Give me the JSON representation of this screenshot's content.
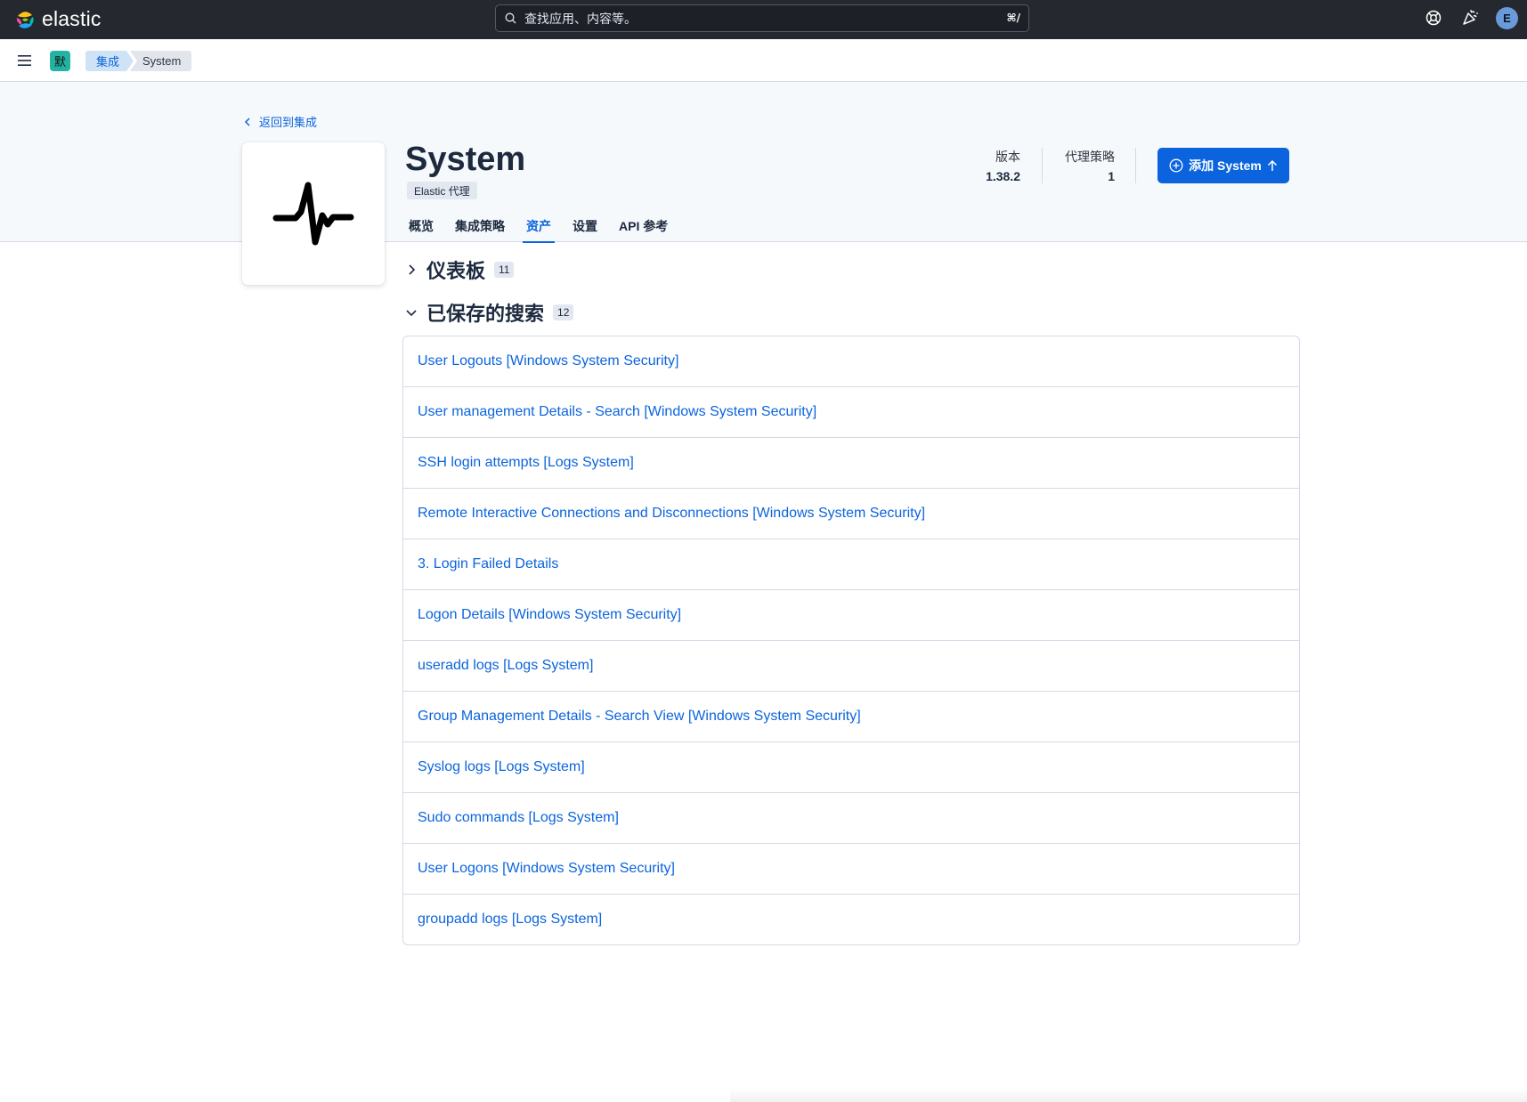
{
  "header": {
    "logo_text": "elastic",
    "search_placeholder": "查找应用、内容等。",
    "search_shortcut": "⌘/",
    "avatar_letter": "E"
  },
  "subbar": {
    "space_label": "默",
    "breadcrumbs": [
      "集成",
      "System"
    ]
  },
  "page": {
    "back_label": "返回到集成",
    "title": "System",
    "badge": "Elastic 代理",
    "tabs": [
      "概览",
      "集成策略",
      "资产",
      "设置",
      "API 参考"
    ],
    "active_tab": "资产",
    "version_label": "版本",
    "version_value": "1.38.2",
    "policies_label": "代理策略",
    "policies_value": "1",
    "add_button": "添加 System"
  },
  "sections": {
    "dashboards": {
      "title": "仪表板",
      "count": "11",
      "expanded": false
    },
    "saved_searches": {
      "title": "已保存的搜索",
      "count": "12",
      "expanded": true,
      "items": [
        "User Logouts [Windows System Security]",
        "User management Details - Search [Windows System Security]",
        "SSH login attempts [Logs System]",
        "Remote Interactive Connections and Disconnections [Windows System Security]",
        "3. Login Failed Details",
        "Logon Details [Windows System Security]",
        "useradd logs [Logs System]",
        "Group Management Details - Search View [Windows System Security]",
        "Syslog logs [Logs System]",
        "Sudo commands [Logs System]",
        "User Logons [Windows System Security]",
        "groupadd logs [Logs System]"
      ]
    }
  },
  "colors": {
    "header_bg": "#25282f",
    "accent": "#0b64dd",
    "space_badge": "#24b3a3"
  }
}
